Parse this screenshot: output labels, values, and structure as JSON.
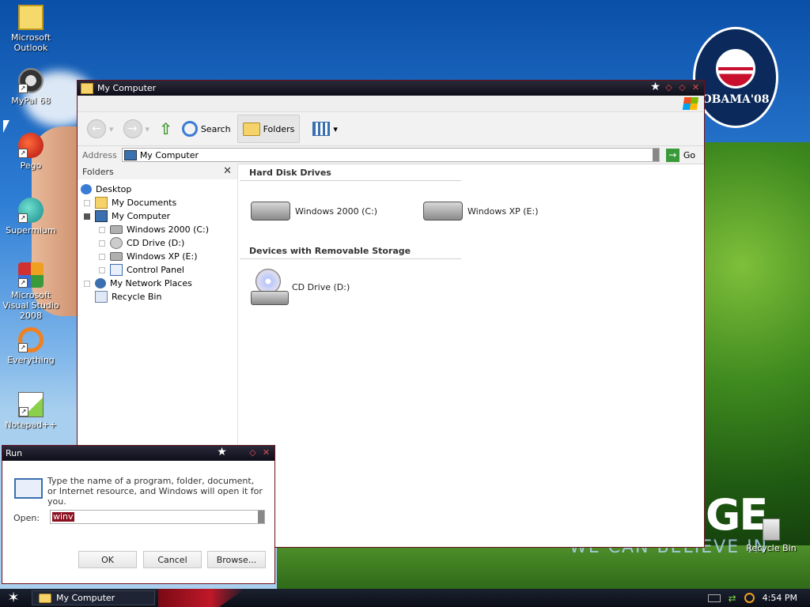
{
  "desktop": {
    "icons": [
      {
        "label": "Microsoft Outlook"
      },
      {
        "label": "MyPal 68"
      },
      {
        "label": "Pego"
      },
      {
        "label": "Supermium"
      },
      {
        "label": "Microsoft Visual Studio 2008"
      },
      {
        "label": "Everything"
      },
      {
        "label": "Notepad++"
      }
    ],
    "recycle_bin": "Recycle Bin",
    "wallpaper_logo": "OBAMA'08",
    "wallpaper_big_text": "GE",
    "wallpaper_slogan": "WE CAN BELIEVE IN"
  },
  "explorer": {
    "title": "My Computer",
    "toolbar": {
      "search": "Search",
      "folders": "Folders"
    },
    "address": {
      "label": "Address",
      "value": "My Computer",
      "go": "Go"
    },
    "folders_pane": {
      "header": "Folders",
      "tree": [
        {
          "label": "Desktop",
          "indent": 0,
          "icon": "desktop-icon"
        },
        {
          "label": "My Documents",
          "indent": 1,
          "icon": "my-documents-icon"
        },
        {
          "label": "My Computer",
          "indent": 1,
          "icon": "my-computer-icon"
        },
        {
          "label": "Windows 2000 (C:)",
          "indent": 2,
          "icon": "hard-drive-icon"
        },
        {
          "label": "CD Drive (D:)",
          "indent": 2,
          "icon": "cd-drive-icon"
        },
        {
          "label": "Windows XP (E:)",
          "indent": 2,
          "icon": "hard-drive-icon"
        },
        {
          "label": "Control Panel",
          "indent": 2,
          "icon": "control-panel-icon"
        },
        {
          "label": "My Network Places",
          "indent": 1,
          "icon": "network-places-icon"
        },
        {
          "label": "Recycle Bin",
          "indent": 1,
          "icon": "recycle-bin-icon"
        }
      ]
    },
    "groups": [
      {
        "title": "Hard Disk Drives",
        "items": [
          "Windows 2000 (C:)",
          "Windows XP (E:)"
        ]
      },
      {
        "title": "Devices with Removable Storage",
        "items": [
          "CD Drive (D:)"
        ]
      }
    ]
  },
  "run_dialog": {
    "title": "Run",
    "description": "Type the name of a program, folder, document, or Internet resource, and Windows will open it for you.",
    "open_label": "Open:",
    "open_value": "winv",
    "ok": "OK",
    "cancel": "Cancel",
    "browse": "Browse..."
  },
  "taskbar": {
    "task": "My Computer",
    "clock": "4:54 PM"
  },
  "colors": {
    "accent": "#8a1020",
    "window_border": "#6a0f1e",
    "titlebar": "#0e0e1a"
  }
}
